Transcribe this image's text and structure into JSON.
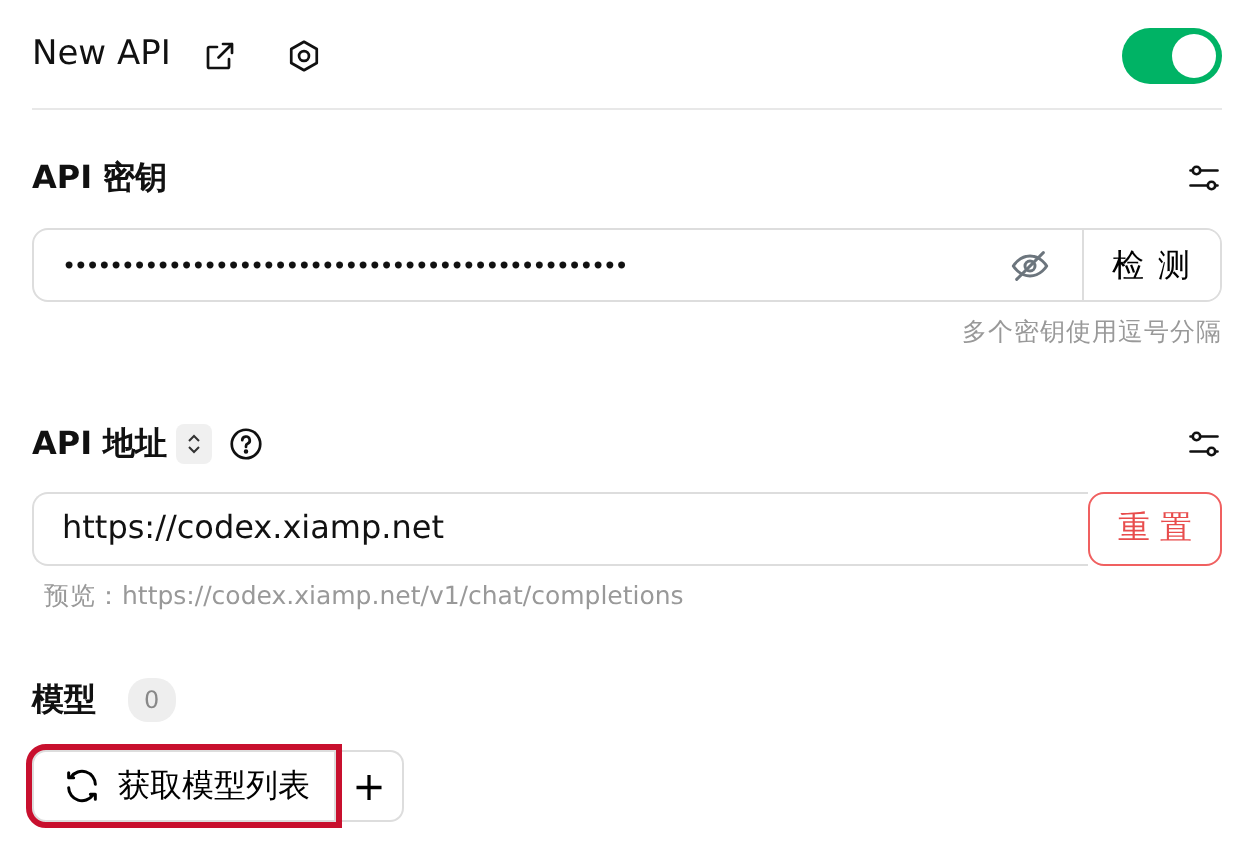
{
  "header": {
    "title": "New API",
    "enabled": true
  },
  "api_key": {
    "label": "API 密钥",
    "value": "••••••••••••••••••••••••••••••••••••••••••••••••",
    "check_button": "检 测",
    "hint": "多个密钥使用逗号分隔"
  },
  "api_url": {
    "label": "API 地址",
    "value": "https://codex.xiamp.net",
    "reset_button": "重 置",
    "preview": "预览：https://codex.xiamp.net/v1/chat/completions"
  },
  "models": {
    "label": "模型",
    "count": "0",
    "fetch_button": "获取模型列表",
    "fetch_highlighted": true,
    "add_button": "+"
  }
}
